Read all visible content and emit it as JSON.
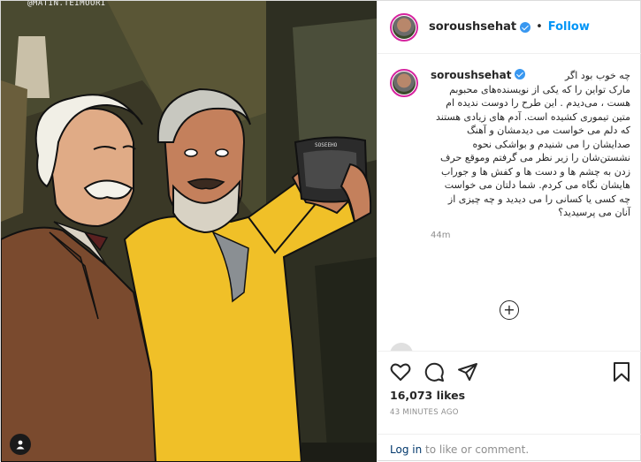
{
  "media": {
    "watermark": "@MATIN.TEIMOORI",
    "camera_label": "SOSEEHO"
  },
  "post": {
    "author": "soroushsehat",
    "verified": true,
    "follow_label": "Follow",
    "dot": "•",
    "caption_author": "soroushsehat",
    "caption": "چه خوب بود اگر\nمارک تواین را که یکی از نویسنده‌های محبوبم هست ، می‌دیدم . این طرح را دوست ندیده ام متین تیموری کشیده است. آدم های زیادی هستند که دلم می خواست می دیدمشان و آهنگ صدایشان را می شنیدم و بواشکی نحوه نشستن‌شان را زیر نظر می گرفتم وموقع حرف زدن به چشم ها و دست ها و کفش ها و جوراب هایشان نگاه می کردم. شما دلتان می خواست چه کسی یا کسانی را می دیدید و چه چیزی از آنان می پرسیدید؟",
    "caption_time": "44m",
    "load_more": "+",
    "likes": "16,073 likes",
    "timestamp": "43 MINUTES AGO",
    "login_link": "Log in",
    "login_rest": " to like or comment."
  },
  "icons": [
    "user-tag-icon",
    "heart-icon",
    "comment-icon",
    "share-icon",
    "bookmark-icon",
    "plus-circle-icon",
    "verified-icon"
  ],
  "colors": {
    "accent": "#0095f6",
    "verified": "#3897f0",
    "text": "#262626",
    "muted": "#8e8e8e"
  }
}
